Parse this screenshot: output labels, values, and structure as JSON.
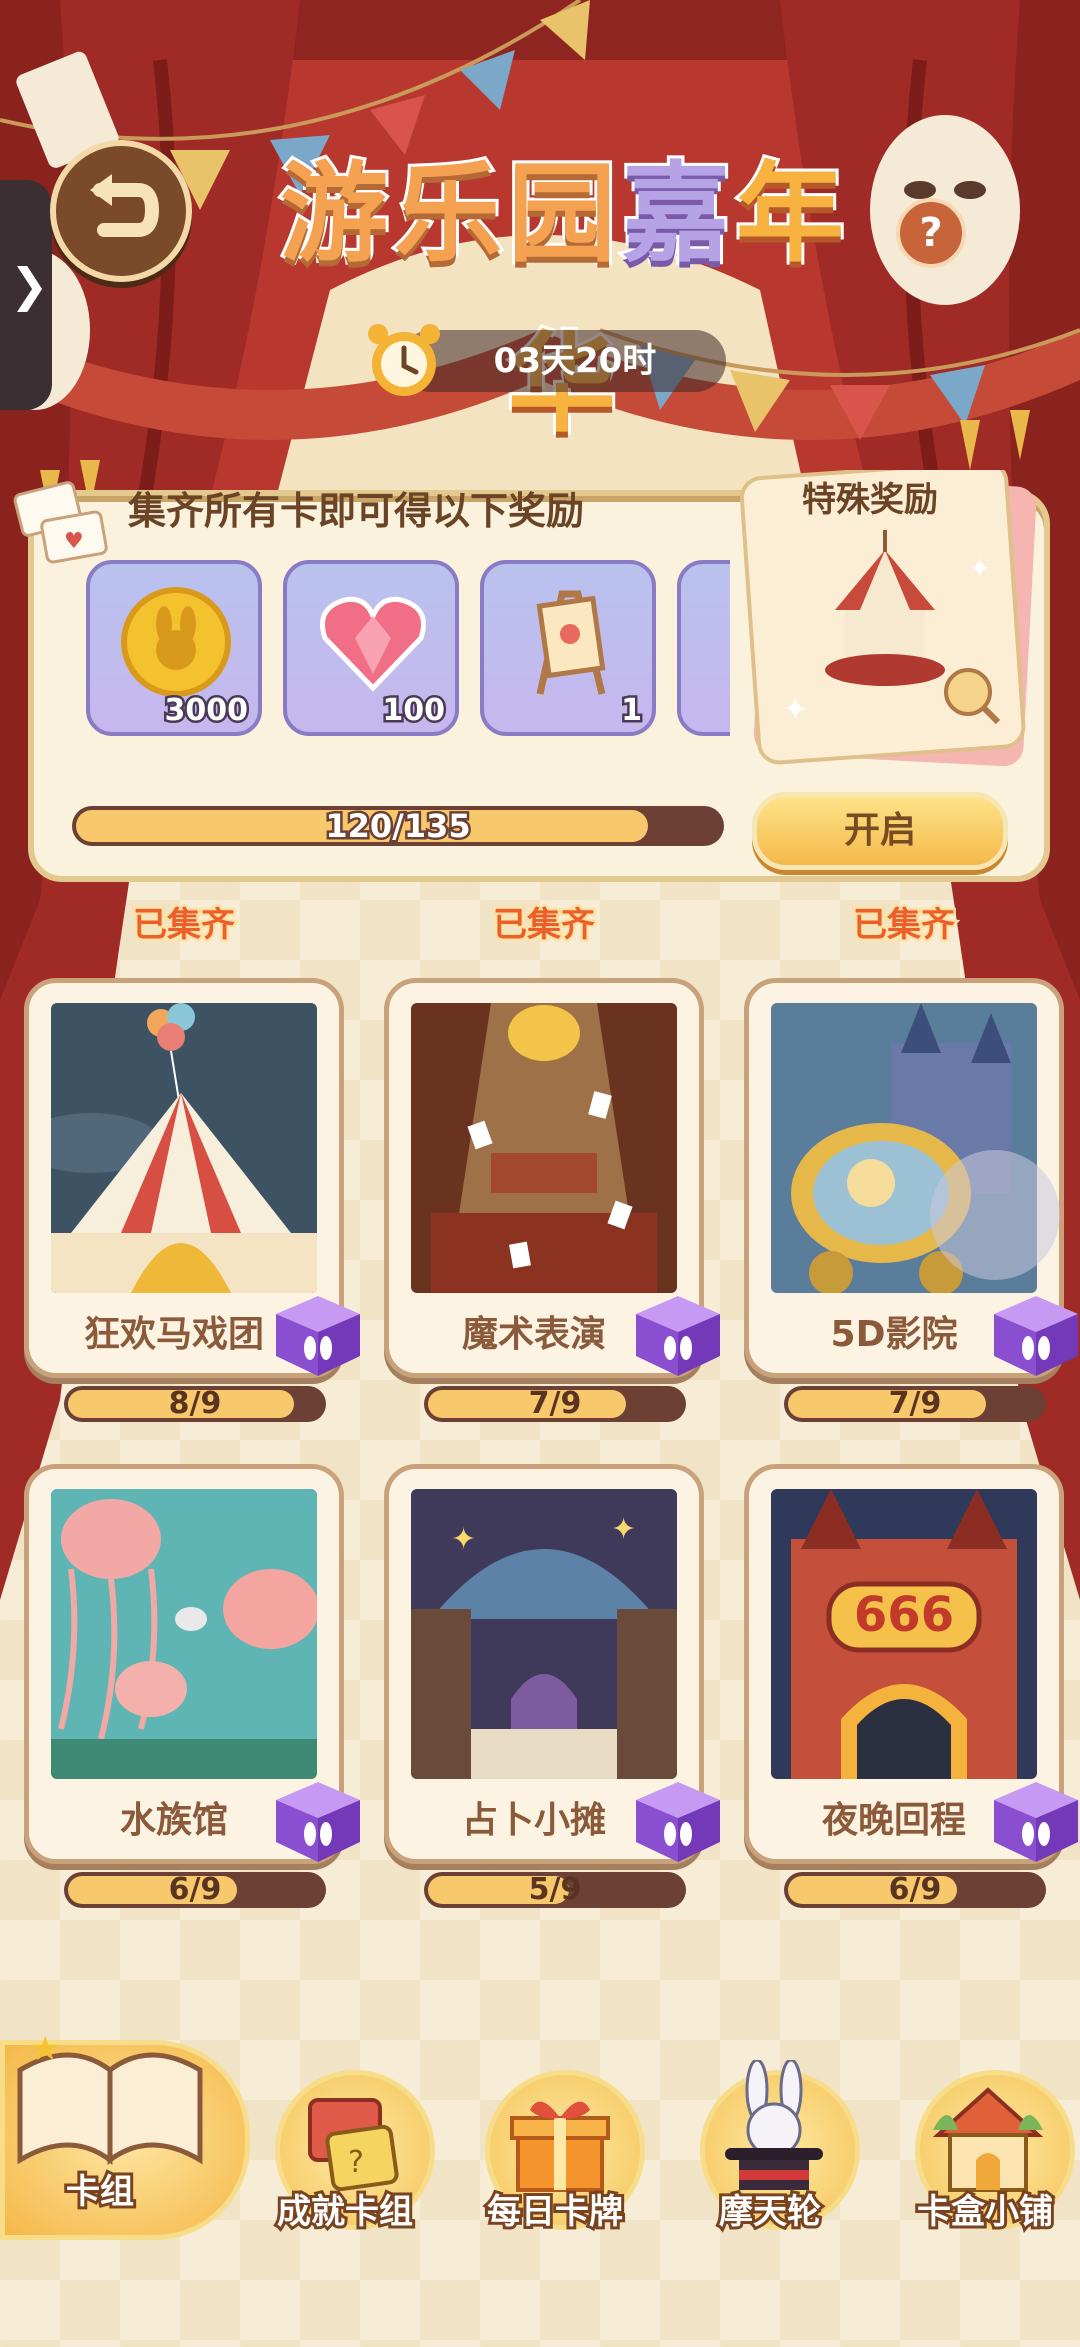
{
  "title": {
    "part1": "游乐园",
    "part2": "嘉",
    "part3": "年华"
  },
  "timer": "03天20时",
  "reward_panel": {
    "header": "集齐所有卡即可得以下奖励",
    "items": [
      {
        "icon": "bunny-coin-icon",
        "qty": "3000"
      },
      {
        "icon": "heart-gem-icon",
        "qty": "100"
      },
      {
        "icon": "easel-sign-icon",
        "qty": "1"
      }
    ],
    "special_label": "特殊奖励",
    "progress": {
      "text": "120/135",
      "value": 120,
      "max": 135
    },
    "open_button": "开启"
  },
  "collected_label": "已集齐",
  "cards": [
    {
      "name": "狂欢马戏团",
      "progress": "8/9",
      "value": 8,
      "max": 9,
      "collected": true
    },
    {
      "name": "魔术表演",
      "progress": "7/9",
      "value": 7,
      "max": 9,
      "collected": true
    },
    {
      "name": "5D影院",
      "progress": "7/9",
      "value": 7,
      "max": 9,
      "collected": true
    },
    {
      "name": "水族馆",
      "progress": "6/9",
      "value": 6,
      "max": 9,
      "collected": false
    },
    {
      "name": "占卜小摊",
      "progress": "5/9",
      "value": 5,
      "max": 9,
      "collected": false
    },
    {
      "name": "夜晚回程",
      "progress": "6/9",
      "value": 6,
      "max": 9,
      "collected": false
    }
  ],
  "castle_sign": "666",
  "nav": [
    {
      "label": "卡组",
      "icon": "card-book-icon",
      "active": true
    },
    {
      "label": "成就卡组",
      "icon": "card-stack-icon",
      "active": false
    },
    {
      "label": "每日卡牌",
      "icon": "gift-box-icon",
      "active": false
    },
    {
      "label": "摩天轮",
      "icon": "magic-hat-bunny-icon",
      "active": false
    },
    {
      "label": "卡盒小铺",
      "icon": "shop-house-icon",
      "active": false
    }
  ],
  "colors": {
    "curtain": "#a8302c",
    "bar_fill": "#f7c86c",
    "bar_track": "#6c4034",
    "accent": "#ec5f2a"
  }
}
